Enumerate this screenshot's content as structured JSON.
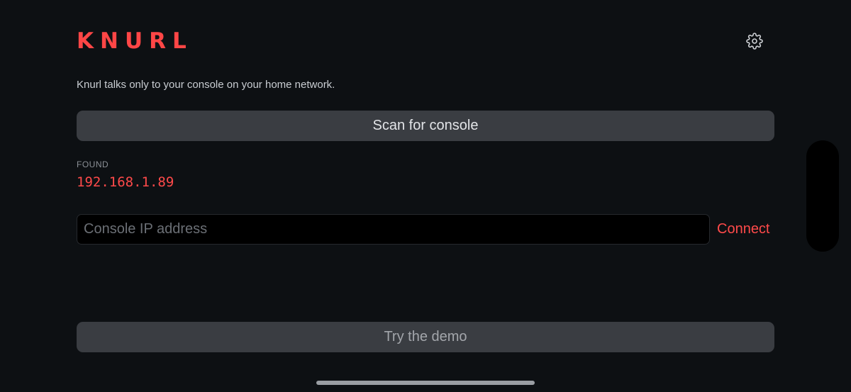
{
  "app": {
    "logo_text": "KNURL",
    "tagline": "Knurl talks only to your console on your home network."
  },
  "header": {
    "settings_icon": "gear-icon"
  },
  "scan": {
    "button_label": "Scan for console"
  },
  "found": {
    "label": "FOUND",
    "ip": "192.168.1.89"
  },
  "manual": {
    "ip_value": "",
    "ip_placeholder": "Console IP address",
    "connect_label": "Connect"
  },
  "demo": {
    "button_label": "Try the demo"
  },
  "colors": {
    "accent": "#ff4646",
    "background": "#0d1013",
    "button": "#3a3d42"
  }
}
